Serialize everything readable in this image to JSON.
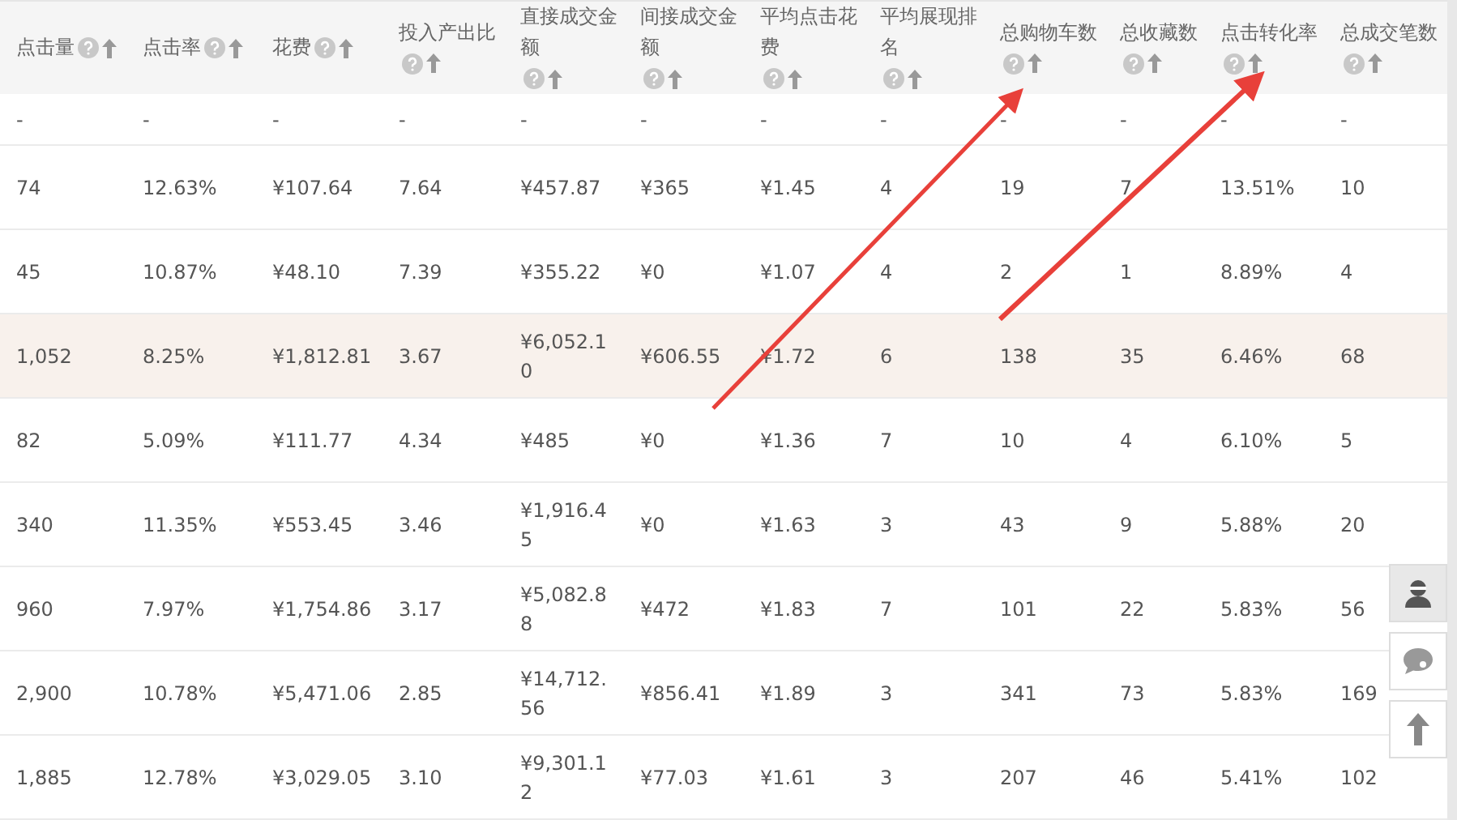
{
  "table": {
    "columns": [
      {
        "label": "点击量"
      },
      {
        "label": "点击率"
      },
      {
        "label": "花费"
      },
      {
        "label": "投入产出比"
      },
      {
        "label": "直接成交金额"
      },
      {
        "label": "间接成交金额"
      },
      {
        "label": "平均点击花费"
      },
      {
        "label": "平均展现排名"
      },
      {
        "label": "总购物车数"
      },
      {
        "label": "总收藏数"
      },
      {
        "label": "点击转化率"
      },
      {
        "label": "总成交笔数"
      }
    ],
    "rows": [
      {
        "highlighted": false,
        "cells": [
          "-",
          "-",
          "-",
          "-",
          "-",
          "-",
          "-",
          "-",
          "-",
          "-",
          "-",
          "-"
        ]
      },
      {
        "highlighted": false,
        "cells": [
          "74",
          "12.63%",
          "¥107.64",
          "7.64",
          "¥457.87",
          "¥365",
          "¥1.45",
          "4",
          "19",
          "7",
          "13.51%",
          "10"
        ]
      },
      {
        "highlighted": false,
        "cells": [
          "45",
          "10.87%",
          "¥48.10",
          "7.39",
          "¥355.22",
          "¥0",
          "¥1.07",
          "4",
          "2",
          "1",
          "8.89%",
          "4"
        ]
      },
      {
        "highlighted": true,
        "cells": [
          "1,052",
          "8.25%",
          "¥1,812.81",
          "3.67",
          "¥6,052.10",
          "¥606.55",
          "¥1.72",
          "6",
          "138",
          "35",
          "6.46%",
          "68"
        ]
      },
      {
        "highlighted": false,
        "cells": [
          "82",
          "5.09%",
          "¥111.77",
          "4.34",
          "¥485",
          "¥0",
          "¥1.36",
          "7",
          "10",
          "4",
          "6.10%",
          "5"
        ]
      },
      {
        "highlighted": false,
        "cells": [
          "340",
          "11.35%",
          "¥553.45",
          "3.46",
          "¥1,916.45",
          "¥0",
          "¥1.63",
          "3",
          "43",
          "9",
          "5.88%",
          "20"
        ]
      },
      {
        "highlighted": false,
        "cells": [
          "960",
          "7.97%",
          "¥1,754.86",
          "3.17",
          "¥5,082.88",
          "¥472",
          "¥1.83",
          "7",
          "101",
          "22",
          "5.83%",
          "56"
        ]
      },
      {
        "highlighted": false,
        "cells": [
          "2,900",
          "10.78%",
          "¥5,471.06",
          "2.85",
          "¥14,712.56",
          "¥856.41",
          "¥1.89",
          "3",
          "341",
          "73",
          "5.83%",
          "169"
        ]
      },
      {
        "highlighted": false,
        "cells": [
          "1,885",
          "12.78%",
          "¥3,029.05",
          "3.10",
          "¥9,301.12",
          "¥77.03",
          "¥1.61",
          "3",
          "207",
          "46",
          "5.41%",
          "102"
        ]
      }
    ]
  },
  "side_buttons": [
    {
      "kind": "service",
      "selected": true
    },
    {
      "kind": "feedback",
      "selected": false
    },
    {
      "kind": "top",
      "selected": false
    }
  ]
}
